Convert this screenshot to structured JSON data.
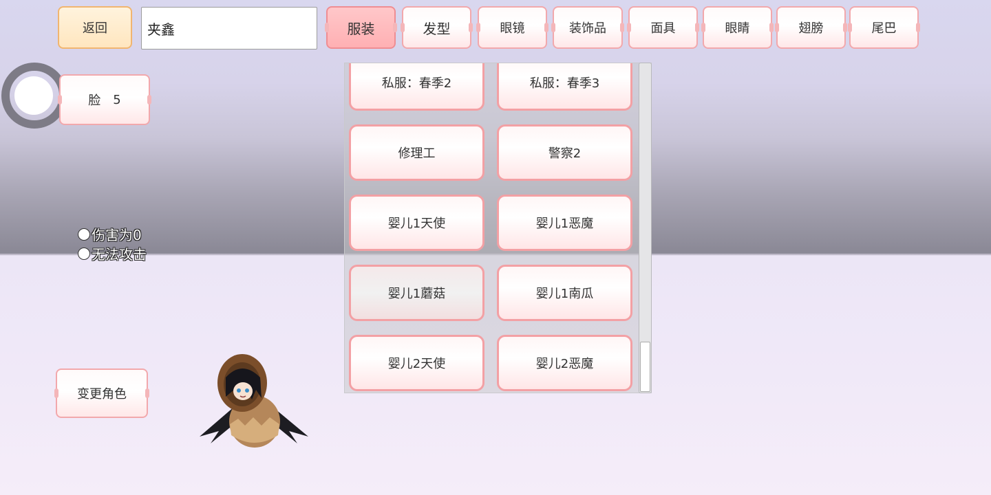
{
  "top_bar": {
    "back_label": "返回",
    "name_value": "夹鑫",
    "tabs": [
      {
        "label": "服装",
        "active": true
      },
      {
        "label": "发型"
      },
      {
        "label": "眼镜"
      },
      {
        "label": "装饰品"
      },
      {
        "label": "面具"
      },
      {
        "label": "眼睛"
      },
      {
        "label": "翅膀"
      },
      {
        "label": "尾巴"
      }
    ]
  },
  "face_button": {
    "label": "脸",
    "value": "5"
  },
  "status_lines": [
    "伤害为0",
    "无法攻击"
  ],
  "change_character_label": "变更角色",
  "outfit_list": [
    "私服：春季2",
    "私服：春季3",
    "修理工",
    "警察2",
    "婴儿1天使",
    "婴儿1恶魔",
    "婴儿1蘑菇",
    "婴儿1南瓜",
    "婴儿2天使",
    "婴儿2恶魔"
  ],
  "colors": {
    "accent_border": "#f2a8ac",
    "active_tab": "#ffb0b3",
    "back_button": "#ffe6bf"
  }
}
